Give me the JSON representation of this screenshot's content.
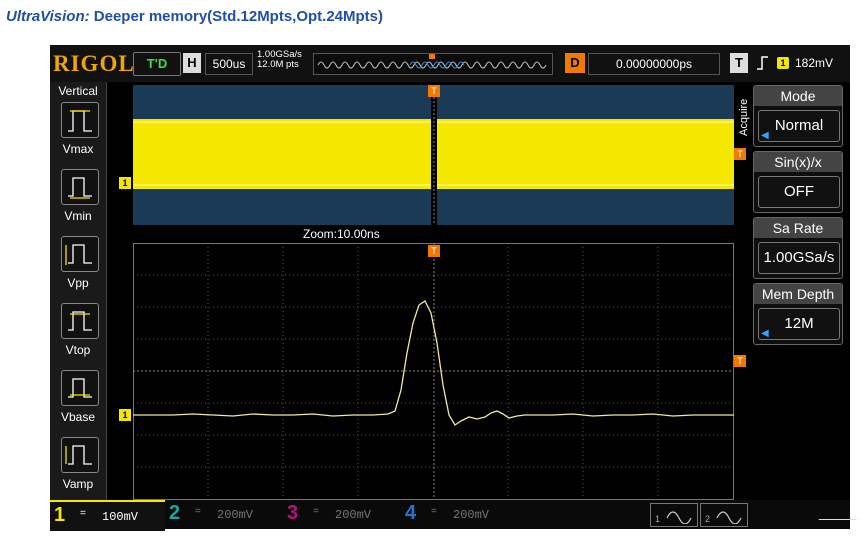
{
  "headline": {
    "brand": "UltraVision:",
    "text": " Deeper memory(Std.12Mpts,Opt.24Mpts)"
  },
  "topbar": {
    "logo": "RIGOL",
    "run_status": "T'D",
    "horizontal_label": "H",
    "timebase": "500us",
    "sample_rate": "1.00GSa/s",
    "memory_depth": "12.0M pts",
    "delay_label": "D",
    "delay_value": "0.00000000ps",
    "trigger_label": "T",
    "trigger_channel": "1",
    "trigger_level": "182mV"
  },
  "left_panel": {
    "title": "Vertical",
    "items": [
      "Vmax",
      "Vmin",
      "Vpp",
      "Vtop",
      "Vbase",
      "Vamp"
    ]
  },
  "screen": {
    "zoom_label": "Zoom:10.00ns",
    "side_label": "Acquire",
    "channel_marker": "1",
    "trigger_marker": "T",
    "colors": {
      "ch1": "#f5e800",
      "main_bg": "#1b3a55",
      "grid": "#5a5a5a"
    }
  },
  "menu": [
    {
      "title": "Mode",
      "value": "Normal",
      "arrow": true
    },
    {
      "title": "Sin(x)/x",
      "value": "OFF",
      "arrow": false
    },
    {
      "title": "Sa Rate",
      "value": "1.00GSa/s",
      "arrow": false
    },
    {
      "title": "Mem Depth",
      "value": "12M",
      "arrow": true
    }
  ],
  "channels": [
    {
      "num": "1",
      "coupling": "=",
      "scale": "100mV",
      "color": "#f5e800",
      "active": true
    },
    {
      "num": "2",
      "coupling": "=",
      "scale": "200mV",
      "color": "#1fa3a3",
      "active": false
    },
    {
      "num": "3",
      "coupling": "=",
      "scale": "200mV",
      "color": "#b5127f",
      "active": false
    },
    {
      "num": "4",
      "coupling": "=",
      "scale": "200mV",
      "color": "#2a72d0",
      "active": false
    }
  ],
  "generators": [
    "1",
    "2"
  ]
}
